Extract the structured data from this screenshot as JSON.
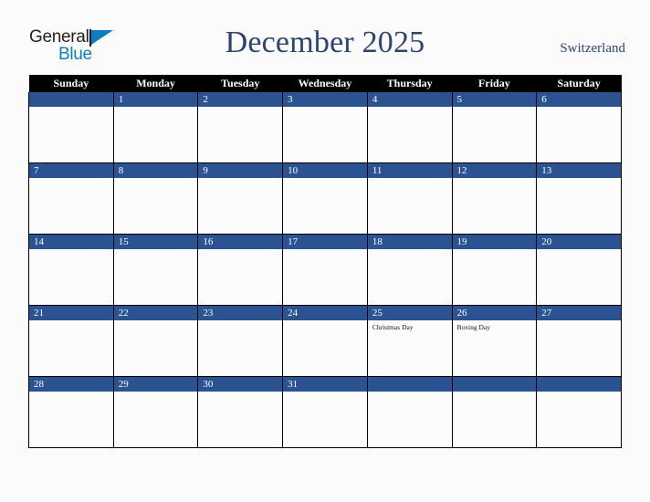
{
  "brand": {
    "name_part1": "General",
    "name_part2": "Blue",
    "triangle_icon": "triangle-icon",
    "primary_color": "#0f7dc2"
  },
  "header": {
    "title": "December 2025",
    "country": "Switzerland",
    "title_color": "#2e4470"
  },
  "calendar": {
    "month": "December",
    "year": "2025",
    "accent_color": "#2b5291",
    "header_bg": "#000000",
    "weekdays": [
      "Sunday",
      "Monday",
      "Tuesday",
      "Wednesday",
      "Thursday",
      "Friday",
      "Saturday"
    ],
    "weeks": [
      [
        {
          "day": "",
          "events": []
        },
        {
          "day": "1",
          "events": []
        },
        {
          "day": "2",
          "events": []
        },
        {
          "day": "3",
          "events": []
        },
        {
          "day": "4",
          "events": []
        },
        {
          "day": "5",
          "events": []
        },
        {
          "day": "6",
          "events": []
        }
      ],
      [
        {
          "day": "7",
          "events": []
        },
        {
          "day": "8",
          "events": []
        },
        {
          "day": "9",
          "events": []
        },
        {
          "day": "10",
          "events": []
        },
        {
          "day": "11",
          "events": []
        },
        {
          "day": "12",
          "events": []
        },
        {
          "day": "13",
          "events": []
        }
      ],
      [
        {
          "day": "14",
          "events": []
        },
        {
          "day": "15",
          "events": []
        },
        {
          "day": "16",
          "events": []
        },
        {
          "day": "17",
          "events": []
        },
        {
          "day": "18",
          "events": []
        },
        {
          "day": "19",
          "events": []
        },
        {
          "day": "20",
          "events": []
        }
      ],
      [
        {
          "day": "21",
          "events": []
        },
        {
          "day": "22",
          "events": []
        },
        {
          "day": "23",
          "events": []
        },
        {
          "day": "24",
          "events": []
        },
        {
          "day": "25",
          "events": [
            "Christmas Day"
          ]
        },
        {
          "day": "26",
          "events": [
            "Boxing Day"
          ]
        },
        {
          "day": "27",
          "events": []
        }
      ],
      [
        {
          "day": "28",
          "events": []
        },
        {
          "day": "29",
          "events": []
        },
        {
          "day": "30",
          "events": []
        },
        {
          "day": "31",
          "events": []
        },
        {
          "day": "",
          "events": []
        },
        {
          "day": "",
          "events": []
        },
        {
          "day": "",
          "events": []
        }
      ]
    ]
  }
}
